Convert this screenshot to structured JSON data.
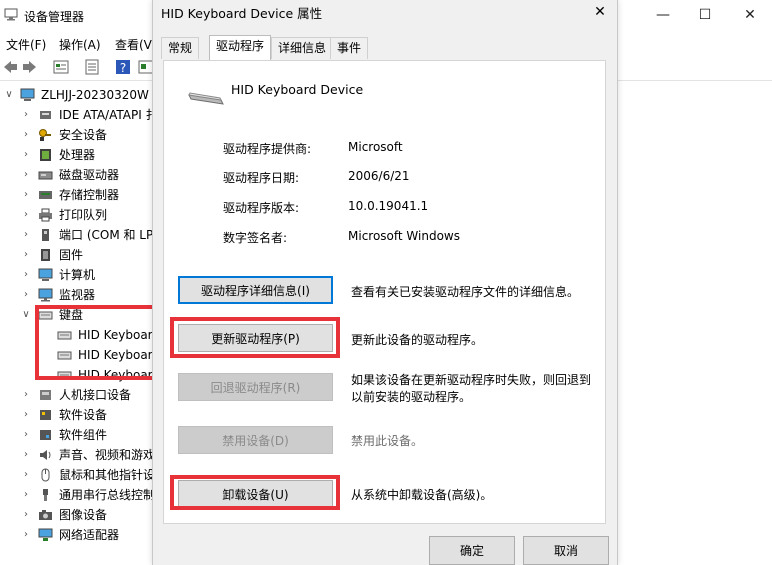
{
  "device_manager": {
    "title": "设备管理器",
    "menu": [
      "文件(F)",
      "操作(A)",
      "查看(V"
    ],
    "tree": {
      "root": "ZLHJJ-20230320W",
      "categories": [
        {
          "label": "IDE ATA/ATAPI 扌",
          "icon": "ide-controller-icon"
        },
        {
          "label": "安全设备",
          "icon": "security-key-icon"
        },
        {
          "label": "处理器",
          "icon": "processor-icon"
        },
        {
          "label": "磁盘驱动器",
          "icon": "disk-drive-icon"
        },
        {
          "label": "存储控制器",
          "icon": "storage-controller-icon"
        },
        {
          "label": "打印队列",
          "icon": "printer-icon"
        },
        {
          "label": "端口 (COM 和 LP",
          "icon": "port-icon"
        },
        {
          "label": "固件",
          "icon": "firmware-icon"
        },
        {
          "label": "计算机",
          "icon": "computer-icon"
        },
        {
          "label": "监视器",
          "icon": "monitor-icon"
        },
        {
          "label": "键盘",
          "icon": "keyboard-icon"
        }
      ],
      "keyboard_children": [
        "HID Keyboar",
        "HID Keyboar",
        "HID Keyboar"
      ],
      "categories_after": [
        {
          "label": "人机接口设备",
          "icon": "hid-icon"
        },
        {
          "label": "软件设备",
          "icon": "software-device-icon"
        },
        {
          "label": "软件组件",
          "icon": "software-component-icon"
        },
        {
          "label": "声音、视频和游戏",
          "icon": "sound-icon"
        },
        {
          "label": "鼠标和其他指针设",
          "icon": "mouse-icon"
        },
        {
          "label": "通用串行总线控制",
          "icon": "usb-icon"
        },
        {
          "label": "图像设备",
          "icon": "camera-icon"
        },
        {
          "label": "网络适配器",
          "icon": "network-adapter-icon"
        }
      ]
    }
  },
  "dialog": {
    "title": "HID Keyboard Device 属性",
    "tabs": [
      "常规",
      "驱动程序",
      "详细信息",
      "事件"
    ],
    "active_tab": "驱动程序",
    "device_name": "HID Keyboard Device",
    "info": [
      {
        "label": "驱动程序提供商:",
        "value": "Microsoft"
      },
      {
        "label": "驱动程序日期:",
        "value": "2006/6/21"
      },
      {
        "label": "驱动程序版本:",
        "value": "10.0.19041.1"
      },
      {
        "label": "数字签名者:",
        "value": "Microsoft Windows"
      }
    ],
    "actions": [
      {
        "button": "驱动程序详细信息(I)",
        "desc": "查看有关已安装驱动程序文件的详细信息。",
        "enabled": true
      },
      {
        "button": "更新驱动程序(P)",
        "desc": "更新此设备的驱动程序。",
        "enabled": true
      },
      {
        "button": "回退驱动程序(R)",
        "desc": "如果该设备在更新驱动程序时失败，则回退到以前安装的驱动程序。",
        "enabled": false
      },
      {
        "button": "禁用设备(D)",
        "desc": "禁用此设备。",
        "enabled": false
      },
      {
        "button": "卸载设备(U)",
        "desc": "从系统中卸载设备(高级)。",
        "enabled": true
      }
    ],
    "ok_label": "确定",
    "cancel_label": "取消"
  },
  "colors": {
    "highlight_box": "#e8323a",
    "focus_border": "#0078d7"
  }
}
